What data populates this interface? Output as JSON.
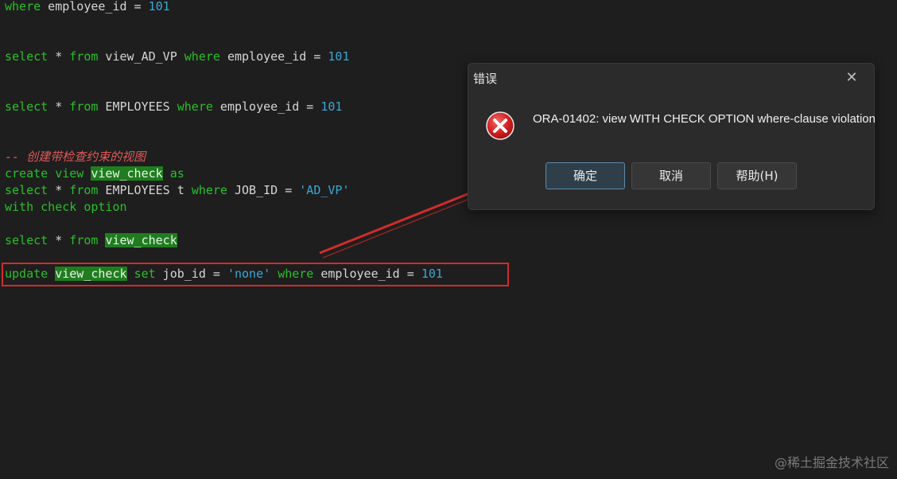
{
  "editor": {
    "line1": {
      "kw1": "where",
      "t1": " employee_id = ",
      "n1": "101"
    },
    "line2": {
      "kw1": "select",
      "t1": " * ",
      "kw2": "from",
      "t2": " view_AD_VP ",
      "kw3": "where",
      "t3": " employee_id = ",
      "n1": "101"
    },
    "line3": {
      "kw1": "select",
      "t1": " * ",
      "kw2": "from",
      "t2": " EMPLOYEES ",
      "kw3": "where",
      "t3": " employee_id = ",
      "n1": "101"
    },
    "comment": "-- 创建带检查约束的视图",
    "line5": {
      "kw1": "create",
      "t1": " ",
      "kw2": "view",
      "t2": " ",
      "hl": "view_check",
      "t3": " ",
      "kw3": "as"
    },
    "line6": {
      "kw1": "select",
      "t1": " * ",
      "kw2": "from",
      "t2": " EMPLOYEES t ",
      "kw3": "where",
      "t3": " JOB_ID = ",
      "s1": "'AD_VP'"
    },
    "line7": {
      "kw1": "with",
      "t1": " ",
      "kw2": "check",
      "t2": " ",
      "kw3": "option"
    },
    "line8": {
      "kw1": "select",
      "t1": " * ",
      "kw2": "from",
      "t2": " ",
      "hl": "view_check"
    },
    "line9": {
      "kw1": "update",
      "t1": " ",
      "hl": "view_check",
      "t2": " ",
      "kw2": "set",
      "t3": " job_id = ",
      "s1": "'none'",
      "t4": " ",
      "kw3": "where",
      "t5": " employee_id = ",
      "n1": "101"
    }
  },
  "dialog": {
    "title": "错误",
    "close_icon": "close-icon",
    "error_icon": "error-icon",
    "message": "ORA-01402: view WITH CHECK OPTION where-clause violation",
    "buttons": {
      "ok": "确定",
      "cancel": "取消",
      "help": "帮助(H)"
    }
  },
  "watermark": "@稀土掘金技术社区",
  "colors": {
    "keyword": "#2bbf2b",
    "number": "#3aa7d6",
    "comment": "#e05a5a",
    "highlight": "#1f7d1f",
    "annotation": "#d02c2c",
    "background": "#1e1e1e"
  }
}
